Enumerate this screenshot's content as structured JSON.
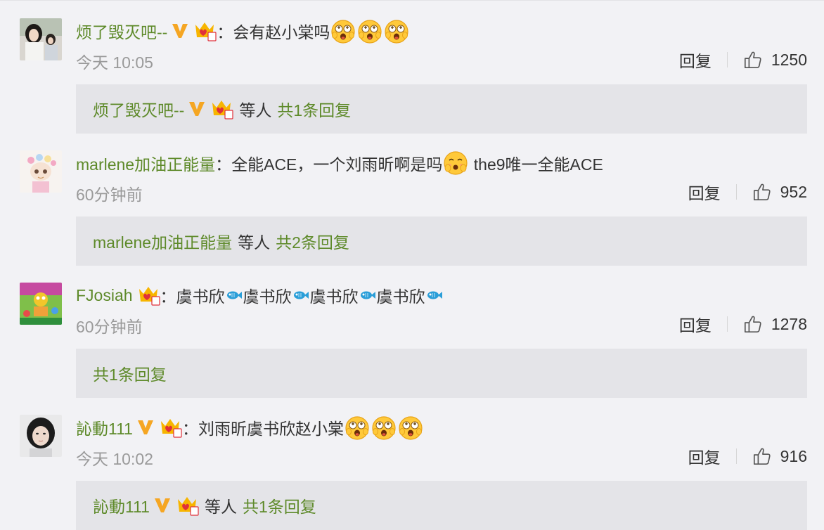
{
  "comments": [
    {
      "username": "烦了毁灭吧--",
      "has_v_badge": true,
      "crown_level": "3",
      "separator": "：",
      "text": "会有赵小棠吗",
      "trailing_emoji_count": 3,
      "time": "今天 10:05",
      "reply_label": "回复",
      "likes": "1250",
      "reply_box": {
        "user": "烦了毁灭吧--",
        "etc": "等人",
        "count_text": "共1条回复"
      }
    },
    {
      "username": "marlene加油正能量",
      "has_v_badge": false,
      "separator": "：",
      "text": "全能ACE，一个刘雨昕啊是吗",
      "text_after_emoji": " the9唯一全能ACE",
      "time": "60分钟前",
      "reply_label": "回复",
      "likes": "952",
      "reply_box": {
        "user": "marlene加油正能量",
        "etc": "等人",
        "count_text": "共2条回复"
      }
    },
    {
      "username": "FJosiah",
      "has_v_badge": false,
      "crown_level": "2",
      "separator": "：",
      "text_parts": [
        "虞书欣",
        "虞书欣",
        "虞书欣",
        "虞书欣"
      ],
      "time": "60分钟前",
      "reply_label": "回复",
      "likes": "1278",
      "reply_box": {
        "count_text": "共1条回复"
      }
    },
    {
      "username": "訫動111",
      "has_v_badge": true,
      "crown_level": "1",
      "separator": "：",
      "text": "刘雨昕虞书欣赵小棠",
      "trailing_emoji_count": 3,
      "time": "今天 10:02",
      "reply_label": "回复",
      "likes": "916",
      "reply_box": {
        "user": "訫動111",
        "etc": "等人",
        "count_text": "共1条回复"
      }
    }
  ],
  "colors": {
    "background": "#f2f2f5",
    "username": "#5e8a2a",
    "meta": "#9a9a9a",
    "reply_box": "#e4e4e8",
    "v_badge": "#f5a623",
    "crown": "#f7b500"
  }
}
